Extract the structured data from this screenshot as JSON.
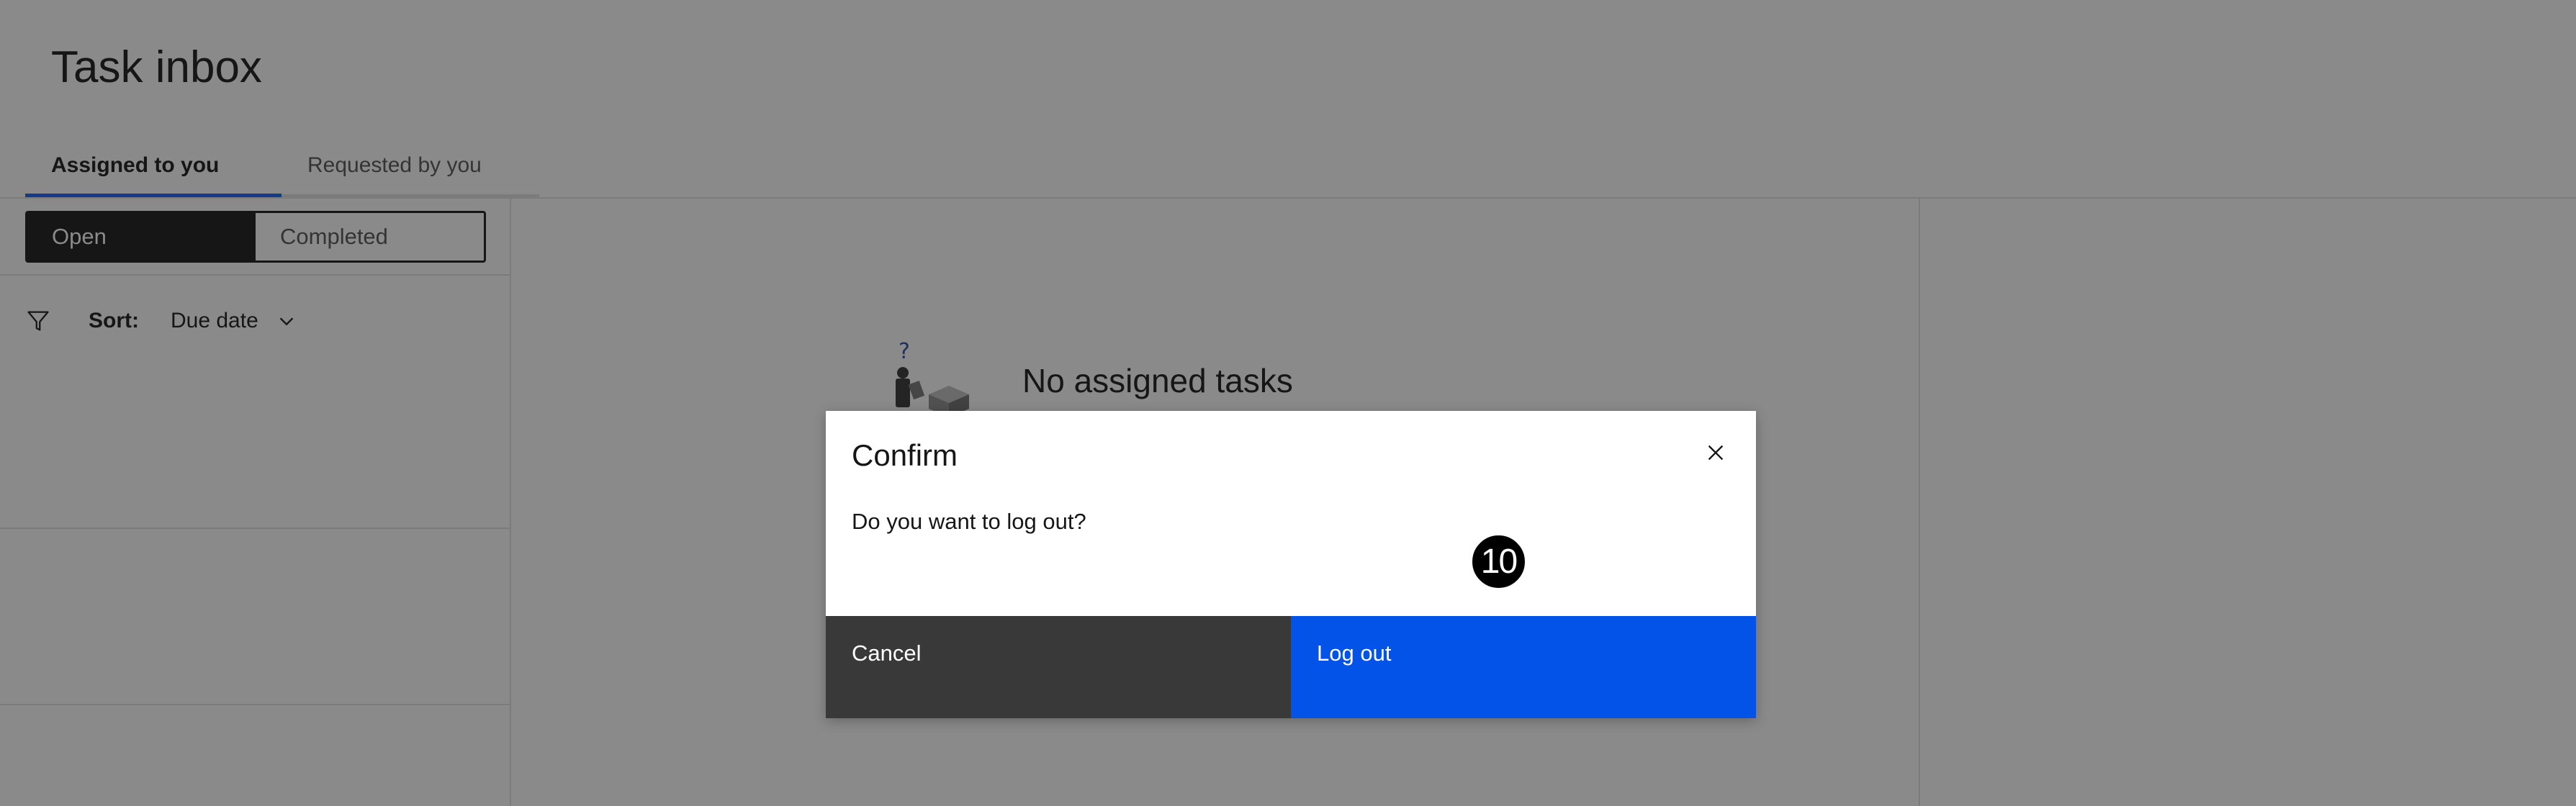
{
  "page": {
    "title": "Task inbox"
  },
  "tabs": [
    {
      "label": "Assigned to you",
      "active": true
    },
    {
      "label": "Requested by you",
      "active": false
    }
  ],
  "status_filter": {
    "options": [
      "Open",
      "Completed"
    ],
    "selected": "Open"
  },
  "sort": {
    "label": "Sort:",
    "value": "Due date"
  },
  "empty_state": {
    "title": "No assigned tasks",
    "illustration_mark": "?"
  },
  "modal": {
    "title": "Confirm",
    "body": "Do you want to log out?",
    "cancel_label": "Cancel",
    "confirm_label": "Log out"
  },
  "step_badge": {
    "label": "10"
  },
  "colors": {
    "primary_button": "#0353e9",
    "secondary_button": "#393939",
    "active_tab_indicator": "#0f62fe",
    "overlay": "rgba(22,22,22,0.5)"
  },
  "icons": {
    "filter": "filter-icon",
    "chevron": "chevron-down-icon",
    "close": "close-icon"
  }
}
